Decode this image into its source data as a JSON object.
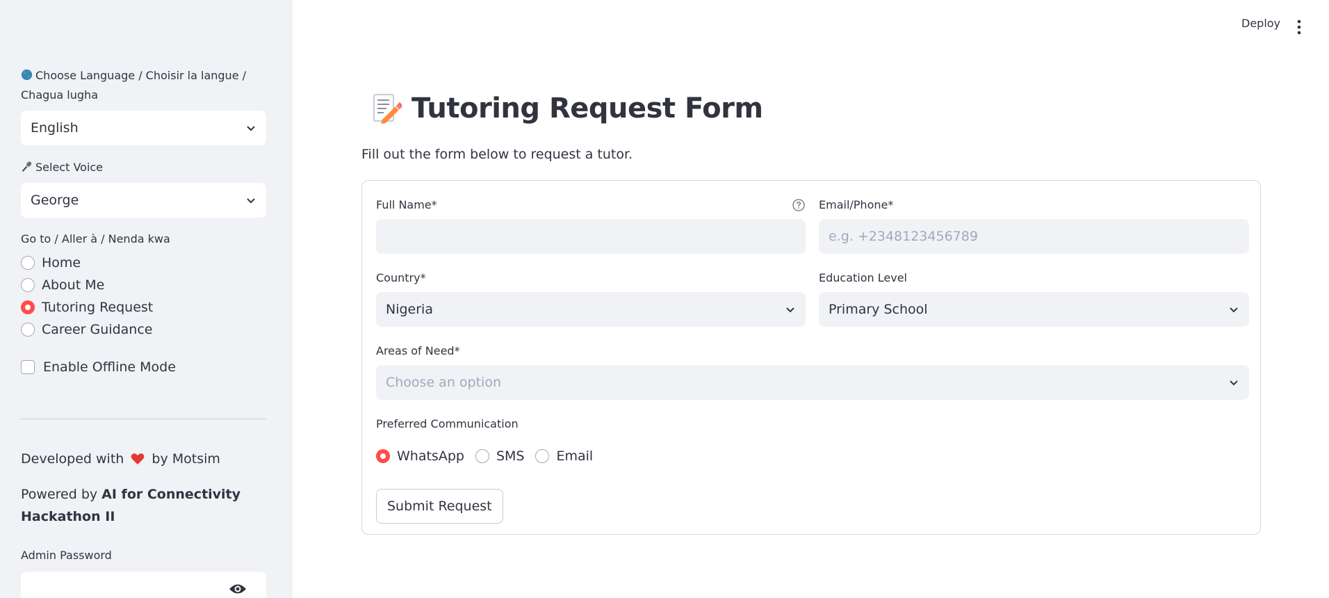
{
  "header": {
    "deploy_label": "Deploy"
  },
  "sidebar": {
    "language_label": "Choose Language / Choisir la langue / Chagua lugha",
    "language_value": "English",
    "voice_label": "Select Voice",
    "voice_value": "George",
    "nav_label": "Go to / Aller à / Nenda kwa",
    "nav_items": [
      {
        "label": "Home",
        "selected": false
      },
      {
        "label": "About Me",
        "selected": false
      },
      {
        "label": "Tutoring Request",
        "selected": true
      },
      {
        "label": "Career Guidance",
        "selected": false
      }
    ],
    "offline_label": "Enable Offline Mode",
    "developed_prefix": "Developed with",
    "developed_suffix": "by Motsim",
    "powered_prefix": "Powered by",
    "powered_bold": "AI for Connectivity Hackathon II",
    "admin_label": "Admin Password",
    "admin_value": ""
  },
  "main": {
    "title": "Tutoring Request Form",
    "subtitle": "Fill out the form below to request a tutor.",
    "fields": {
      "full_name_label": "Full Name*",
      "full_name_value": "",
      "email_label": "Email/Phone*",
      "email_placeholder": "e.g. +2348123456789",
      "country_label": "Country*",
      "country_value": "Nigeria",
      "education_label": "Education Level",
      "education_value": "Primary School",
      "areas_label": "Areas of Need*",
      "areas_placeholder": "Choose an option",
      "comm_label": "Preferred Communication",
      "comm_options": [
        {
          "label": "WhatsApp",
          "selected": true
        },
        {
          "label": "SMS",
          "selected": false
        },
        {
          "label": "Email",
          "selected": false
        }
      ]
    },
    "submit_label": "Submit Request"
  },
  "colors": {
    "accent": "#ff4b4b",
    "sidebar_bg": "#f0f2f6",
    "input_bg": "#f0f2f6",
    "text": "#31333f"
  },
  "icons": {
    "globe": "globe-icon",
    "mic": "microphone-icon",
    "memo": "memo-icon",
    "heart": "heart-icon",
    "eye": "eye-icon",
    "help": "help-icon"
  }
}
